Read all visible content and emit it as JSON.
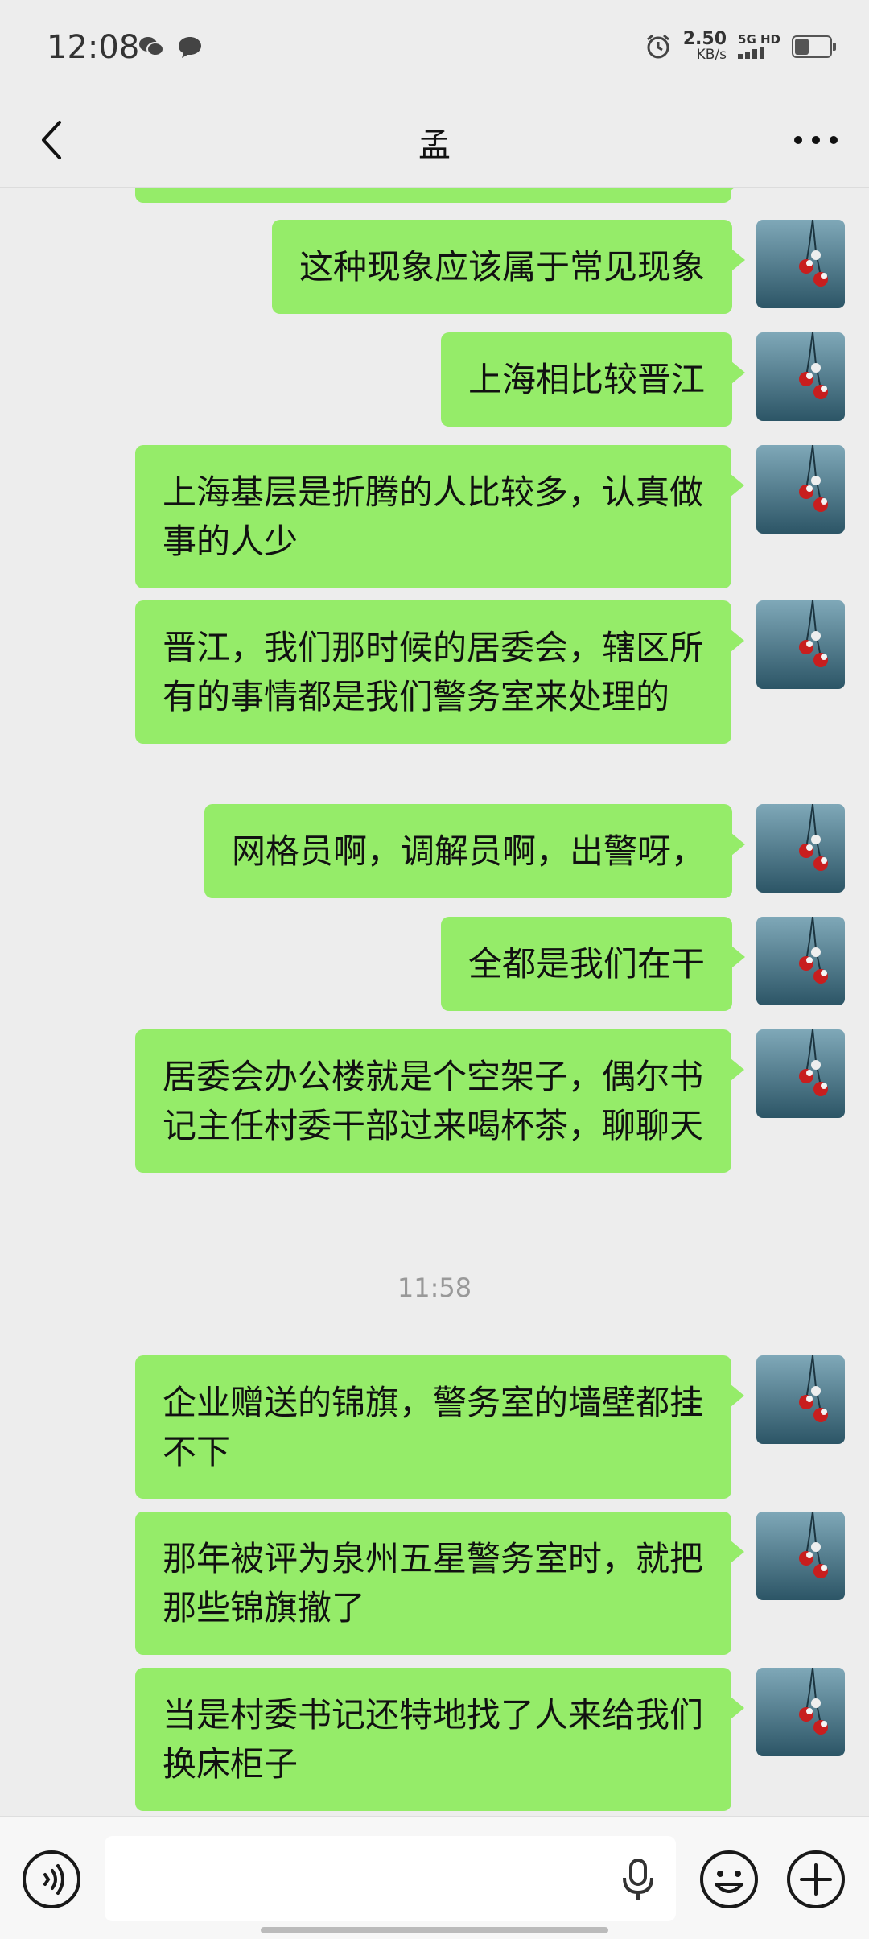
{
  "status_bar": {
    "time": "12:08",
    "net_speed_value": "2.50",
    "net_speed_unit": "KB/s",
    "network_label": "5G HD",
    "battery_level": 0.4,
    "left_icons": [
      "wechat-icon",
      "message-icon"
    ],
    "right_icons": [
      "alarm-icon",
      "signal-icon",
      "battery-icon"
    ]
  },
  "header": {
    "title": "孟",
    "back_icon": "chevron-left-icon",
    "more_icon": "more-icon"
  },
  "timestamp": "11:58",
  "messages_before": [
    {
      "text": "这种现象应该属于常见现象"
    },
    {
      "text": "上海相比较晋江"
    },
    {
      "text": "上海基层是折腾的人比较多，认真做事的人少"
    },
    {
      "text": "晋江，我们那时候的居委会，辖区所有的事情都是我们警务室来处理的"
    },
    {
      "text": "网格员啊，调解员啊，出警呀，"
    },
    {
      "text": "全都是我们在干"
    },
    {
      "text": "居委会办公楼就是个空架子，偶尔书记主任村委干部过来喝杯茶，聊聊天"
    }
  ],
  "messages_after": [
    {
      "text": "企业赠送的锦旗，警务室的墙壁都挂不下"
    },
    {
      "text": "那年被评为泉州五星警务室时，就把那些锦旗撤了"
    },
    {
      "text": "当是村委书记还特地找了人来给我们换床柜子"
    }
  ],
  "input_bar": {
    "placeholder": "",
    "value": "",
    "icons": [
      "voice-icon",
      "mic-icon",
      "emoji-icon",
      "plus-icon"
    ]
  },
  "colors": {
    "background": "#ededed",
    "bubble_self": "#95ec69",
    "timestamp_text": "#999999"
  }
}
